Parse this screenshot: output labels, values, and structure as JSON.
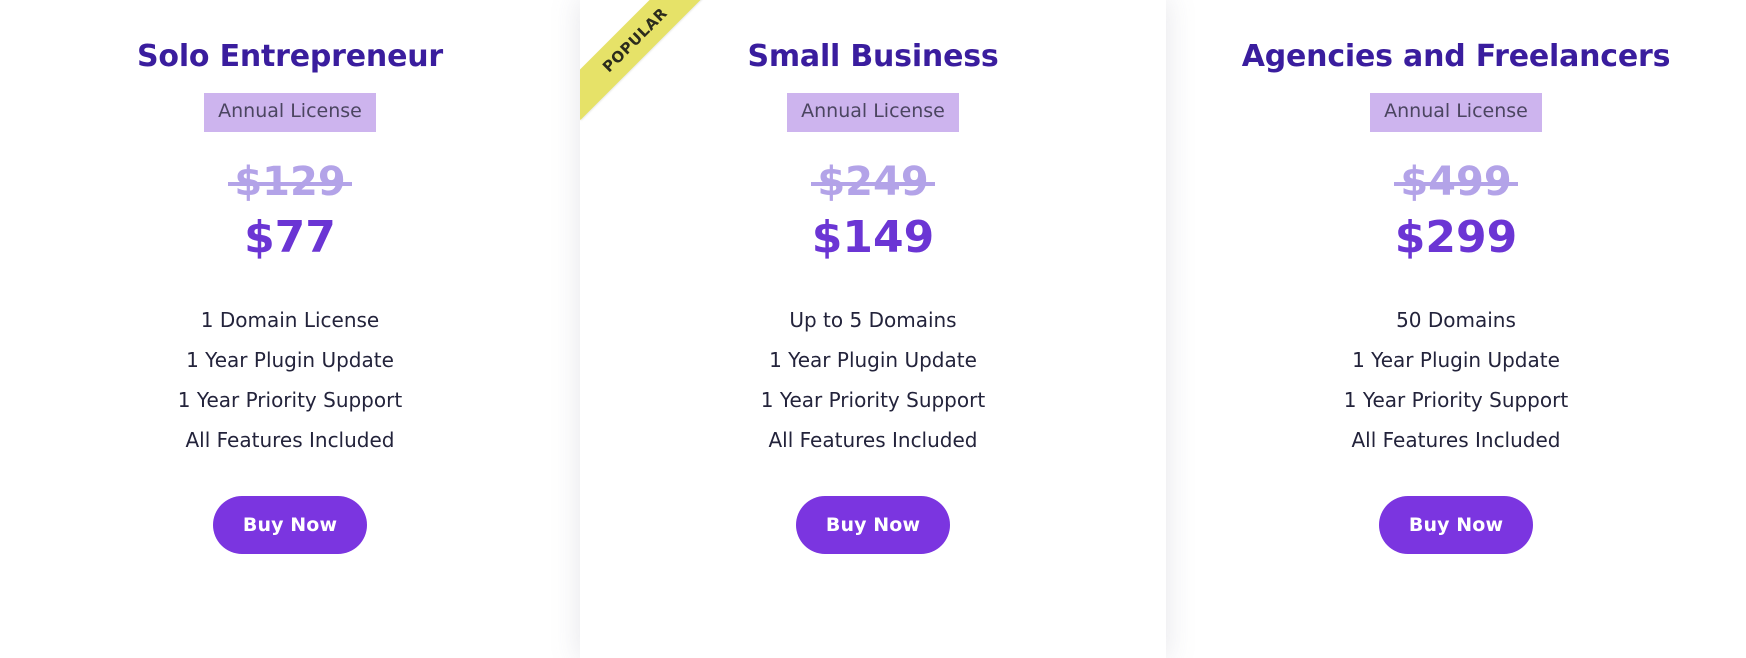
{
  "page": {
    "background_color": "#ffffff",
    "accent_color": "#7b35e0",
    "title_color": "#3a1d9e",
    "ribbon_color": "#e6e268",
    "badge_color": "#cdb4ee",
    "old_price_color": "#b3a3e8",
    "new_price_color": "#6b35d4",
    "feature_color": "#23233b"
  },
  "plans": [
    {
      "id": "solo-entrepreneur",
      "title": "Solo Entrepreneur",
      "license_label": "Annual License",
      "old_price": "$129",
      "new_price": "$77",
      "featured": false,
      "ribbon_label": "",
      "features": [
        "1 Domain License",
        "1 Year Plugin Update",
        "1 Year Priority Support",
        "All Features Included"
      ],
      "cta_label": "Buy Now"
    },
    {
      "id": "small-business",
      "title": "Small Business",
      "license_label": "Annual License",
      "old_price": "$249",
      "new_price": "$149",
      "featured": true,
      "ribbon_label": "POPULAR",
      "features": [
        "Up to 5 Domains",
        "1 Year Plugin Update",
        "1 Year Priority Support",
        "All Features Included"
      ],
      "cta_label": "Buy Now"
    },
    {
      "id": "agencies-and-freelancers",
      "title": "Agencies and Freelancers",
      "license_label": "Annual License",
      "old_price": "$499",
      "new_price": "$299",
      "featured": false,
      "ribbon_label": "",
      "features": [
        "50 Domains",
        "1 Year Plugin Update",
        "1 Year Priority Support",
        "All Features Included"
      ],
      "cta_label": "Buy Now"
    }
  ]
}
